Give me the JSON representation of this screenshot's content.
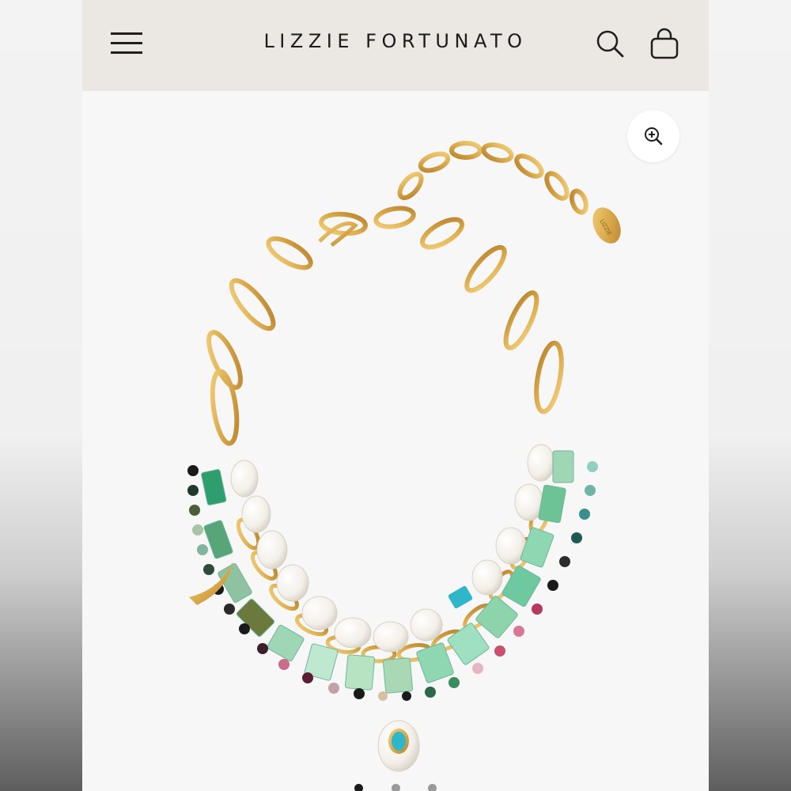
{
  "header": {
    "brand": "LIZZIE FORTUNATO",
    "menu_icon": "hamburger-menu-icon",
    "search_icon": "search-icon",
    "bag_icon": "shopping-bag-icon"
  },
  "product": {
    "image_subject": "layered beaded necklace with gold chain and pearl pendant",
    "zoom_icon": "zoom-in-icon",
    "tag_text": "LIZZIE"
  },
  "carousel": {
    "total_slides": 3,
    "active_slide": 1
  },
  "colors": {
    "header_bg": "#ebe7e2",
    "gold": "#d9a84a",
    "pearl": "#fbf8f2",
    "turquoise": "#2fb6c9",
    "jade": "#8fd6b3"
  }
}
